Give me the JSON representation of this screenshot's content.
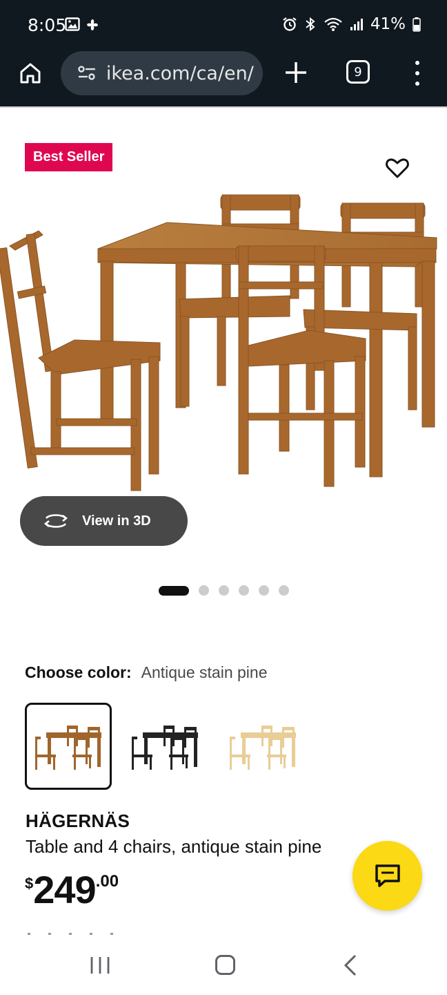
{
  "status_bar": {
    "time": "8:05",
    "battery": "41%",
    "icons_left": [
      "gallery-icon",
      "pinwheel-icon"
    ],
    "icons_right": [
      "alarm-icon",
      "bluetooth-icon",
      "wifi-icon",
      "signal-icon",
      "battery-icon"
    ]
  },
  "browser": {
    "url": "ikea.com/ca/en/",
    "tab_count": "9"
  },
  "product": {
    "badge": "Best Seller",
    "view_3d_label": "View in 3D",
    "carousel": {
      "total": 6,
      "active_index": 0
    },
    "choose_color_label": "Choose color:",
    "selected_color": "Antique stain pine",
    "color_options": [
      "Antique stain pine",
      "Black",
      "Natural pine"
    ],
    "name": "HÄGERNÄS",
    "description": "Table and 4 chairs, antique stain pine",
    "price": {
      "currency": "$",
      "integer": "249",
      "decimal": ".00"
    }
  },
  "colors": {
    "badge": "#e00751",
    "chat_fab": "#fbd914",
    "top_bar": "#101820",
    "view_3d_bg": "#484848"
  }
}
